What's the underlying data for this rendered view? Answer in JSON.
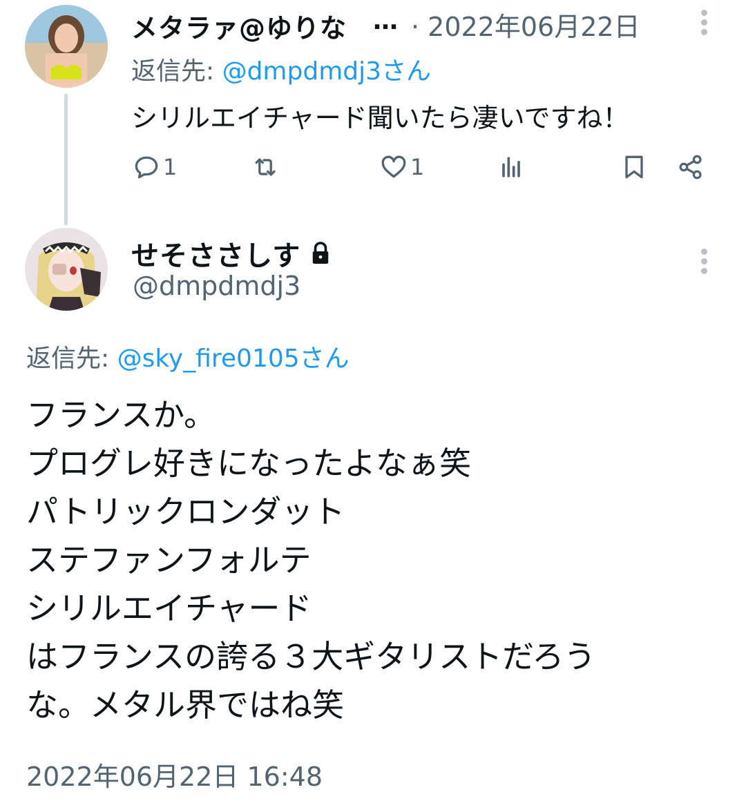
{
  "tweet1": {
    "display_name": "メタラァ@ゆりな",
    "ellipsis": "…",
    "date": "· 2022年06月22日",
    "reply_prefix": "返信先: ",
    "reply_mention": "@dmpdmdj3さん",
    "text": "シリルエイチャード聞いたら凄いですね！",
    "actions": {
      "reply_count": "1",
      "retweet_count": "",
      "like_count": "1"
    }
  },
  "tweet2": {
    "display_name": "せそささしす",
    "handle": "@dmpdmdj3",
    "reply_prefix": "返信先: ",
    "reply_mention": "@sky_fire0105さん",
    "lines": [
      "フランスか。",
      "プログレ好きになったよなぁ笑",
      "パトリックロンダット",
      "ステファンフォルテ",
      "シリルエイチャード",
      "はフランスの誇る３大ギタリストだろう",
      "な。メタル界ではね笑"
    ],
    "timestamp": "2022年06月22日 16:48"
  },
  "colors": {
    "text_primary": "#0f1419",
    "text_secondary": "#536471",
    "link": "#1d9bf0",
    "thread_line": "#cfd9de"
  },
  "icons": {
    "reply": "reply-icon",
    "retweet": "retweet-icon",
    "like": "heart-icon",
    "views": "views-icon",
    "bookmark": "bookmark-icon",
    "share": "share-icon",
    "lock": "lock-icon",
    "more": "more-vertical-icon"
  }
}
